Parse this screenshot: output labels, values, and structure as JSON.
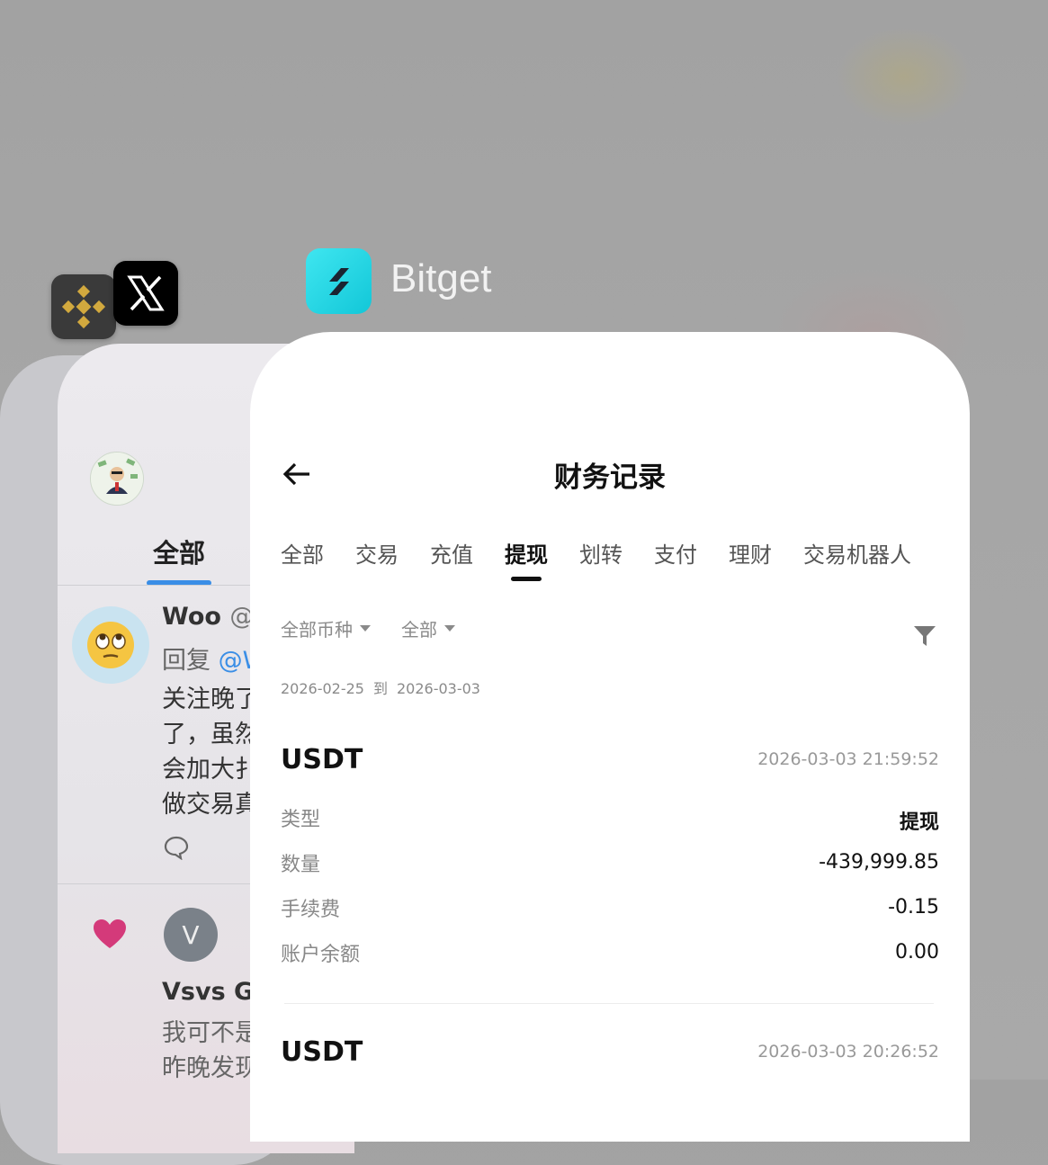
{
  "switcher": {
    "active_app_title": "Bitget",
    "apps": [
      {
        "name": "binance-icon"
      },
      {
        "name": "x-icon"
      },
      {
        "name": "bitget-icon",
        "colors": {
          "accent": "#1ecfe0",
          "dark": "#1b2431"
        }
      }
    ]
  },
  "twitter_card": {
    "tab_label": "全部",
    "post1": {
      "name": "Woo",
      "handle": "@W",
      "reply_prefix": "回复",
      "reply_handle": "@W",
      "lines": [
        "关注晚了",
        "了，虽然",
        "会加大扌",
        "做交易真"
      ]
    },
    "post2": {
      "avatar_letter": "V",
      "name": "Vsvs Gh",
      "lines": [
        "我可不是",
        "昨晚发现"
      ]
    }
  },
  "bitget": {
    "title": "财务记录",
    "tabs": [
      {
        "label": "全部",
        "active": false
      },
      {
        "label": "交易",
        "active": false
      },
      {
        "label": "充值",
        "active": false
      },
      {
        "label": "提现",
        "active": true
      },
      {
        "label": "划转",
        "active": false
      },
      {
        "label": "支付",
        "active": false
      },
      {
        "label": "理财",
        "active": false
      },
      {
        "label": "交易机器人",
        "active": false
      }
    ],
    "filters": {
      "coin": "全部币种",
      "status": "全部"
    },
    "date_range": {
      "from": "2026-02-25",
      "sep": "到",
      "to": "2026-03-03"
    },
    "records": [
      {
        "coin": "USDT",
        "time": "2026-03-03 21:59:52",
        "type_label": "类型",
        "type_value": "提现",
        "amount_label": "数量",
        "amount_value": "-439,999.85",
        "fee_label": "手续费",
        "fee_value": "-0.15",
        "balance_label": "账户余额",
        "balance_value": "0.00"
      },
      {
        "coin": "USDT",
        "time": "2026-03-03 20:26:52"
      }
    ]
  }
}
